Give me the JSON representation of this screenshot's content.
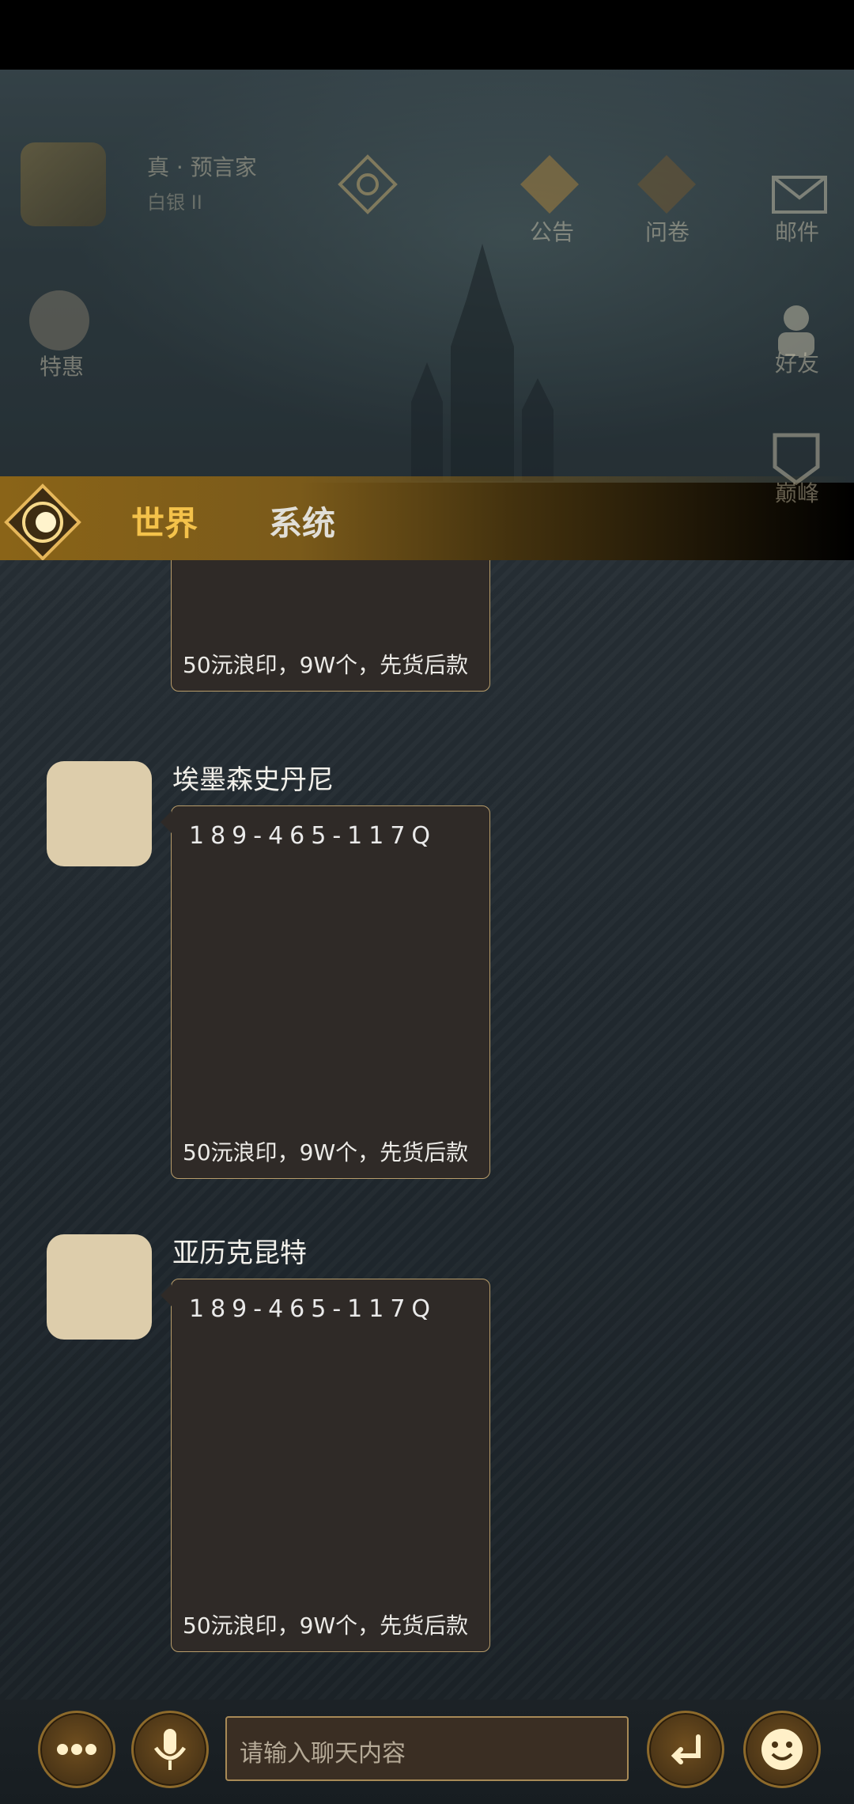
{
  "hud": {
    "player_name": "真 · 预言家",
    "player_rank": "白银 II",
    "buttons": {
      "notice": "公告",
      "survey": "问卷",
      "mail": "邮件",
      "deals": "特惠",
      "friends": "好友",
      "peak": "巅峰"
    }
  },
  "tabs": {
    "world": "世界",
    "system": "系统"
  },
  "messages": [
    {
      "sender": "",
      "line1": "",
      "line2": "50沅浪印，9W个，先货后款"
    },
    {
      "sender": "埃墨森史丹尼",
      "line1": "189-465-117Q",
      "line2": "50沅浪印，9W个，先货后款"
    },
    {
      "sender": "亚历克昆特",
      "line1": "189-465-117Q",
      "line2": "50沅浪印，9W个，先货后款"
    }
  ],
  "input": {
    "placeholder": "请输入聊天内容"
  },
  "colors": {
    "active_tab": "#f4c24a",
    "bubble_border": "#b79c6a",
    "avatar": "#ddcdab"
  }
}
